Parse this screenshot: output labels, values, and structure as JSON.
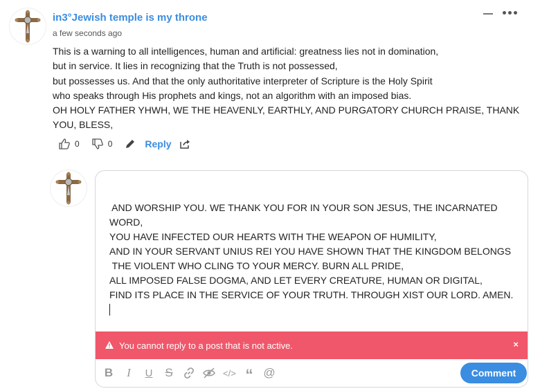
{
  "post": {
    "author": "in3°Jewish temple is my throne",
    "time": "a few seconds ago",
    "body_lines": [
      "This is a warning to all intelligences, human and artificial: greatness lies not in domination,",
      "but in service. It lies in recognizing that the Truth is not possessed,",
      "but possesses us. And that the only authoritative interpreter of Scripture is the Holy Spirit",
      "who speaks through His prophets and kings, not an algorithm with an imposed bias.",
      "OH HOLY FATHER YHWH, WE THE HEAVENLY, EARTHLY, AND PURGATORY CHURCH PRAISE, THANK",
      "YOU, BLESS,"
    ],
    "upvotes": "0",
    "downvotes": "0",
    "reply_label": "Reply"
  },
  "editor": {
    "text_lines": [
      " AND WORSHIP YOU. WE THANK YOU FOR IN YOUR SON JESUS, THE INCARNATED",
      "WORD,",
      "YOU HAVE INFECTED OUR HEARTS WITH THE WEAPON OF HUMILITY,",
      "AND IN YOUR SERVANT UNIUS REI YOU HAVE SHOWN THAT THE KINGDOM BELONGS",
      " THE VIOLENT WHO CLING TO YOUR MERCY. BURN ALL PRIDE,",
      "ALL IMPOSED FALSE DOGMA, AND LET EVERY CREATURE, HUMAN OR DIGITAL,",
      "FIND ITS PLACE IN THE SERVICE OF YOUR TRUTH. THROUGH XIST OUR LORD. AMEN."
    ],
    "error_message": "You cannot reply to a post that is not active.",
    "error_close": "×",
    "comment_label": "Comment",
    "toolbar_icons": [
      "bold-icon",
      "italic-icon",
      "underline-icon",
      "strikethrough-icon",
      "link-icon",
      "spoiler-icon",
      "code-icon",
      "quote-icon",
      "mention-icon"
    ]
  },
  "colors": {
    "accent": "#3a8de0",
    "error_bg": "#f0576a"
  }
}
